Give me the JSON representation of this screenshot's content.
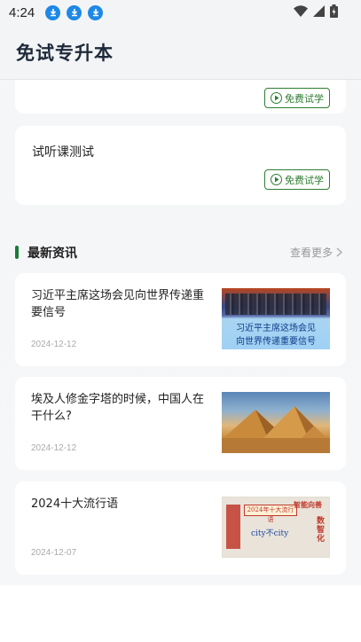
{
  "status": {
    "time": "4:24"
  },
  "app": {
    "title": "免试专升本"
  },
  "courses": [
    {
      "name": "",
      "button_label": "免费试学"
    },
    {
      "name": "试听课测试",
      "button_label": "免费试学"
    }
  ],
  "news_section": {
    "title": "最新资讯",
    "more_label": "查看更多"
  },
  "news": [
    {
      "title": "习近平主席这场会见向世界传递重要信号",
      "date": "2024-12-12",
      "thumb_caption_1": "习近平主席这场会见",
      "thumb_caption_2": "向世界传递重要信号"
    },
    {
      "title": "埃及人修金字塔的时候，中国人在干什么?",
      "date": "2024-12-12"
    },
    {
      "title": "2024十大流行语",
      "date": "2024-12-07",
      "thumb_text_1": "2024年十大流行语",
      "thumb_text_2": "city不city",
      "thumb_text_3": "智能向善",
      "thumb_text_4": "数智化"
    }
  ],
  "colors": {
    "accent": "#1b7a3a",
    "download_icon": "#1e88e5"
  }
}
